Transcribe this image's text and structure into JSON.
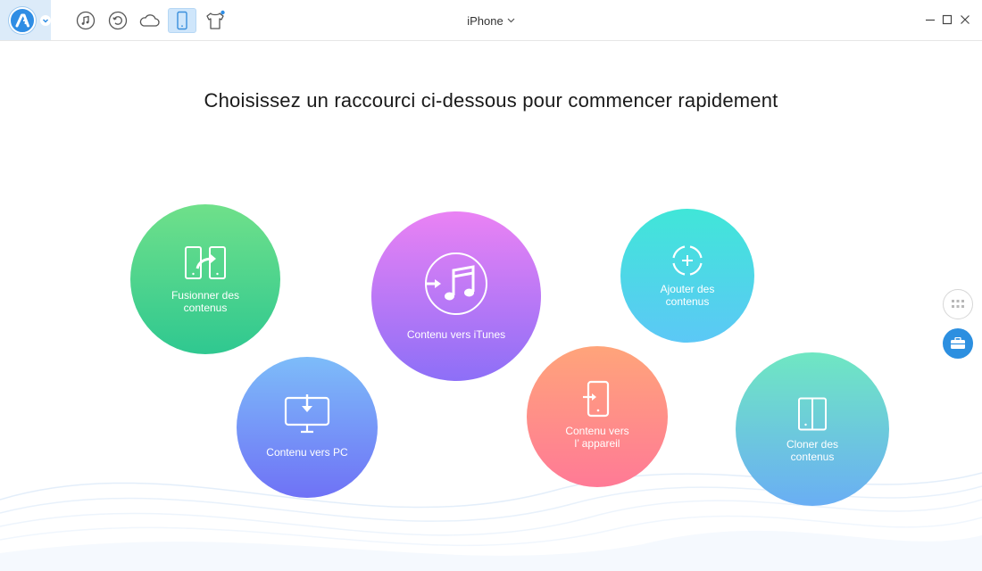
{
  "titlebar": {
    "icons": [
      "music-icon",
      "restore-icon",
      "cloud-icon",
      "phone-icon",
      "tshirt-icon"
    ],
    "active_icon": "phone-icon",
    "device_name": "iPhone",
    "window_controls": [
      "minimize-icon",
      "maximize-icon",
      "close-icon"
    ]
  },
  "main": {
    "heading": "Choisissez un raccourci ci-dessous pour commencer rapidement"
  },
  "shortcuts": {
    "merge": {
      "label_line1": "Fusionner des",
      "label_line2": "contenus",
      "icon": "merge-icon",
      "color_top": "#6fe08a",
      "color_bottom": "#2fc890"
    },
    "to_pc": {
      "label": "Contenu vers PC",
      "icon": "monitor-download-icon",
      "color_top": "#7dbcf9",
      "color_bottom": "#6f72f6"
    },
    "to_itunes": {
      "label": "Contenu vers iTunes",
      "icon": "itunes-icon",
      "color_top": "#ea82f4",
      "color_bottom": "#8d6ff7"
    },
    "to_device": {
      "label_line1": "Contenu vers",
      "label_line2": "l’ appareil",
      "icon": "phone-import-icon",
      "color_top": "#ffa47a",
      "color_bottom": "#ff7a96"
    },
    "add": {
      "label_line1": "Ajouter des",
      "label_line2": "contenus",
      "icon": "add-circle-icon",
      "color_top": "#40e6d8",
      "color_bottom": "#5cc8f6"
    },
    "clone": {
      "label_line1": "Cloner des",
      "label_line2": "contenus",
      "icon": "clone-phone-icon",
      "color_top": "#6fe7c2",
      "color_bottom": "#6aaef4"
    }
  },
  "sidebar": {
    "buttons": [
      "grid-icon",
      "toolbox-icon"
    ]
  },
  "colors": {
    "accent": "#2c8fe0",
    "active_tab_bg": "#cfe6fb"
  }
}
